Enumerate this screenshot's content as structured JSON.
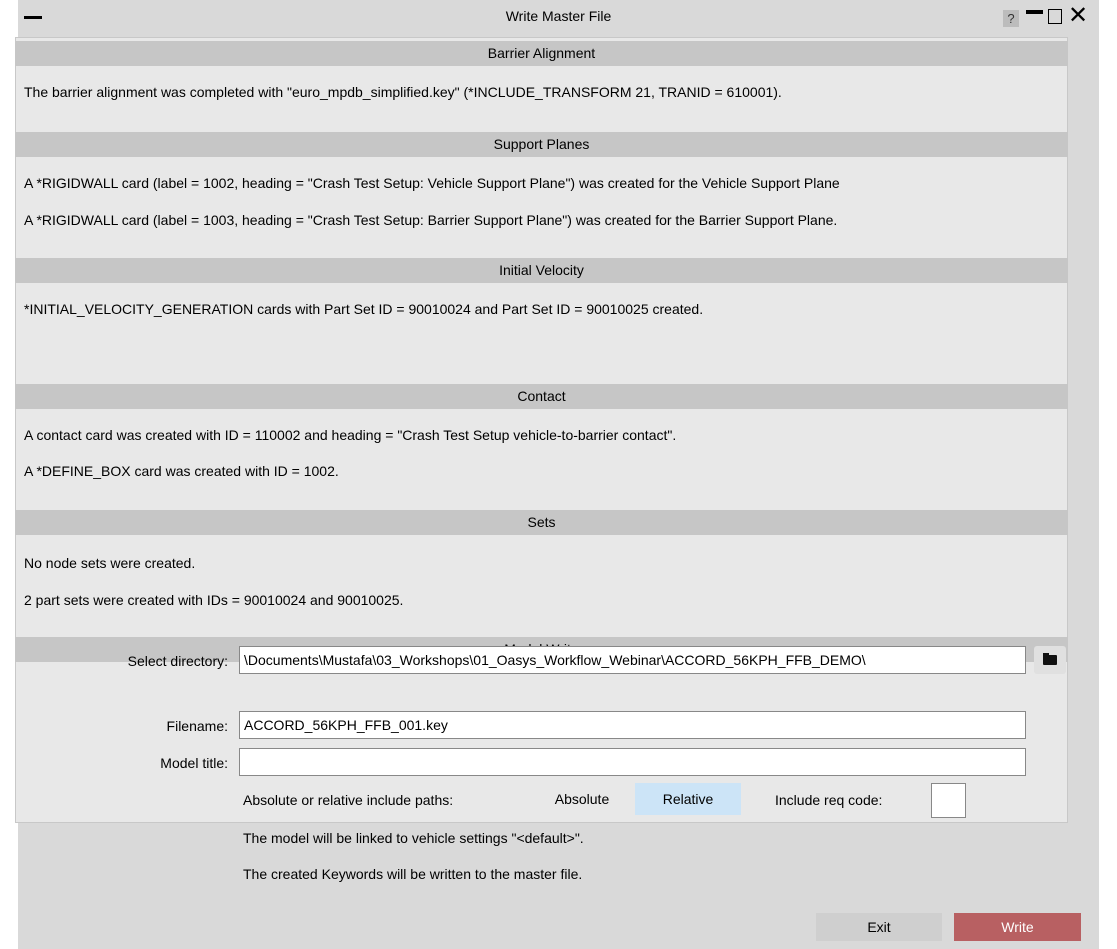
{
  "window": {
    "title": "Write Master File",
    "help": "?"
  },
  "sections": {
    "barrier": {
      "header": "Barrier Alignment",
      "lines": [
        "The barrier alignment was completed with  \"euro_mpdb_simplified.key\" (*INCLUDE_TRANSFORM 21, TRANID = 610001)."
      ]
    },
    "support": {
      "header": "Support Planes",
      "lines": [
        "A  *RIGIDWALL card (label = 1002, heading = \"Crash Test Setup: Vehicle Support Plane\") was created for the Vehicle Support Plane",
        "A  *RIGIDWALL card (label = 1003, heading = \"Crash Test Setup: Barrier Support Plane\") was created for the Barrier Support Plane."
      ]
    },
    "velocity": {
      "header": "Initial Velocity",
      "lines": [
        "*INITIAL_VELOCITY_GENERATION cards with Part Set ID = 90010024 and Part Set ID = 90010025 created."
      ]
    },
    "contact": {
      "header": "Contact",
      "lines": [
        "A contact card was created with ID = 110002 and heading = \"Crash Test Setup vehicle-to-barrier contact\".",
        "A *DEFINE_BOX card was created with ID = 1002."
      ]
    },
    "sets": {
      "header": "Sets",
      "lines": [
        "No node sets were created.",
        "2 part sets were created with IDs = 90010024 and 90010025."
      ]
    },
    "model_write": {
      "header": "Model Write",
      "directory_label": "Select directory:",
      "directory_value": "\\Documents\\Mustafa\\03_Workshops\\01_Oasys_Workflow_Webinar\\ACCORD_56KPH_FFB_DEMO\\",
      "filename_label": "Filename:",
      "filename_value": "ACCORD_56KPH_FFB_001.key",
      "title_label": "Model title:",
      "title_value": "",
      "paths_label": "Absolute or relative include paths:",
      "absolute_label": "Absolute",
      "relative_label": "Relative",
      "include_req_label": "Include req code:",
      "vehicle_settings_text": "The model will be linked to vehicle settings \"<default>\".",
      "keywords_text": "The created Keywords will be written to the master file."
    }
  },
  "buttons": {
    "exit": "Exit",
    "write": "Write"
  },
  "colors": {
    "section_header_bg": "#c6c6c6",
    "panel_bg": "#e8e8e8",
    "selected_option_bg": "#cce4f7",
    "write_button_bg": "#b86062",
    "exit_button_bg": "#cfcfcf"
  }
}
